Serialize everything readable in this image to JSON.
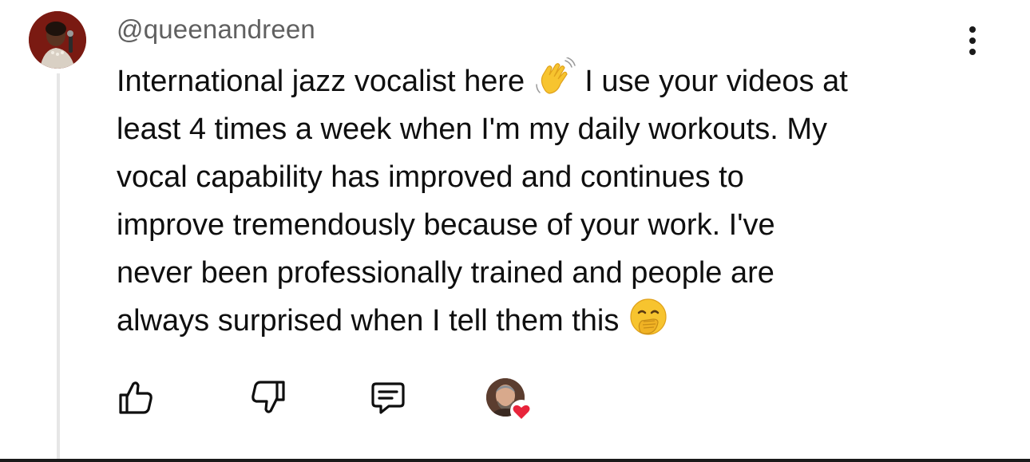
{
  "comment": {
    "author_handle": "@queenandreen",
    "text_lines": [
      {
        "text": "International jazz vocalist here",
        "emoji": "waving-hand",
        "after": "I use your videos at"
      },
      {
        "text": "least 4 times a week when I'm my daily workouts. My"
      },
      {
        "text": "vocal capability has improved and continues to"
      },
      {
        "text": "improve tremendously because of your work. I've"
      },
      {
        "text": "never been professionally trained and people are"
      },
      {
        "text": "always surprised when I tell them this",
        "emoji": "face-with-hand-over-mouth"
      }
    ]
  },
  "actions": {
    "like_icon": "thumbs-up-icon",
    "dislike_icon": "thumbs-down-icon",
    "reply_icon": "comment-reply-icon",
    "creator_heart_icon": "heart-icon"
  },
  "colors": {
    "handle": "#606060",
    "text": "#0f0f0f",
    "heart": "#e8243b",
    "thread_line": "#e6e6e6"
  }
}
